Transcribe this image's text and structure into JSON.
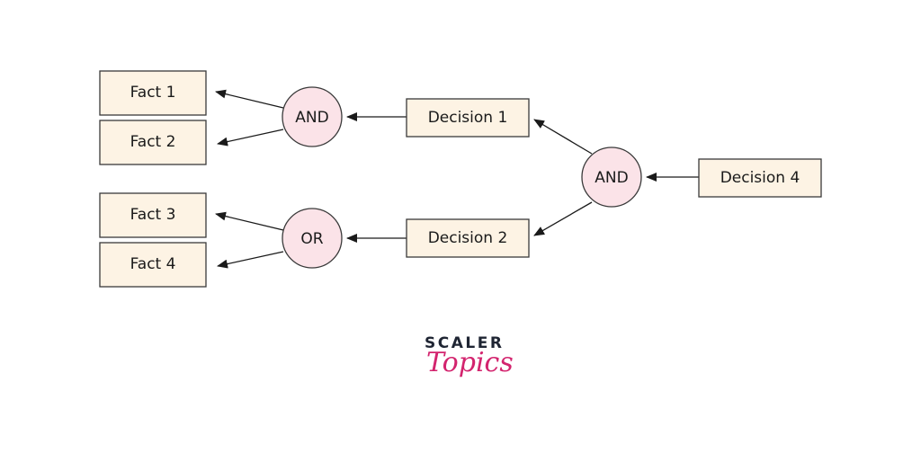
{
  "diagram": {
    "type": "backward-chaining decision tree",
    "nodes": {
      "fact1": "Fact 1",
      "fact2": "Fact 2",
      "fact3": "Fact 3",
      "fact4": "Fact 4",
      "gate_and_top": "AND",
      "gate_or": "OR",
      "gate_and_right": "AND",
      "decision1": "Decision 1",
      "decision2": "Decision 2",
      "decision4": "Decision 4"
    },
    "edges": [
      {
        "from": "decision4",
        "to": "gate_and_right"
      },
      {
        "from": "gate_and_right",
        "to": "decision1"
      },
      {
        "from": "gate_and_right",
        "to": "decision2"
      },
      {
        "from": "decision1",
        "to": "gate_and_top"
      },
      {
        "from": "decision2",
        "to": "gate_or"
      },
      {
        "from": "gate_and_top",
        "to": "fact1"
      },
      {
        "from": "gate_and_top",
        "to": "fact2"
      },
      {
        "from": "gate_or",
        "to": "fact3"
      },
      {
        "from": "gate_or",
        "to": "fact4"
      }
    ],
    "colors": {
      "box_fill": "#fdf3e4",
      "gate_fill": "#fbe3e8",
      "stroke": "#1a1a1a"
    }
  },
  "logo": {
    "top": "SCALER",
    "bottom": "Topics",
    "color_top": "#1f2533",
    "color_bottom": "#d3246e"
  }
}
